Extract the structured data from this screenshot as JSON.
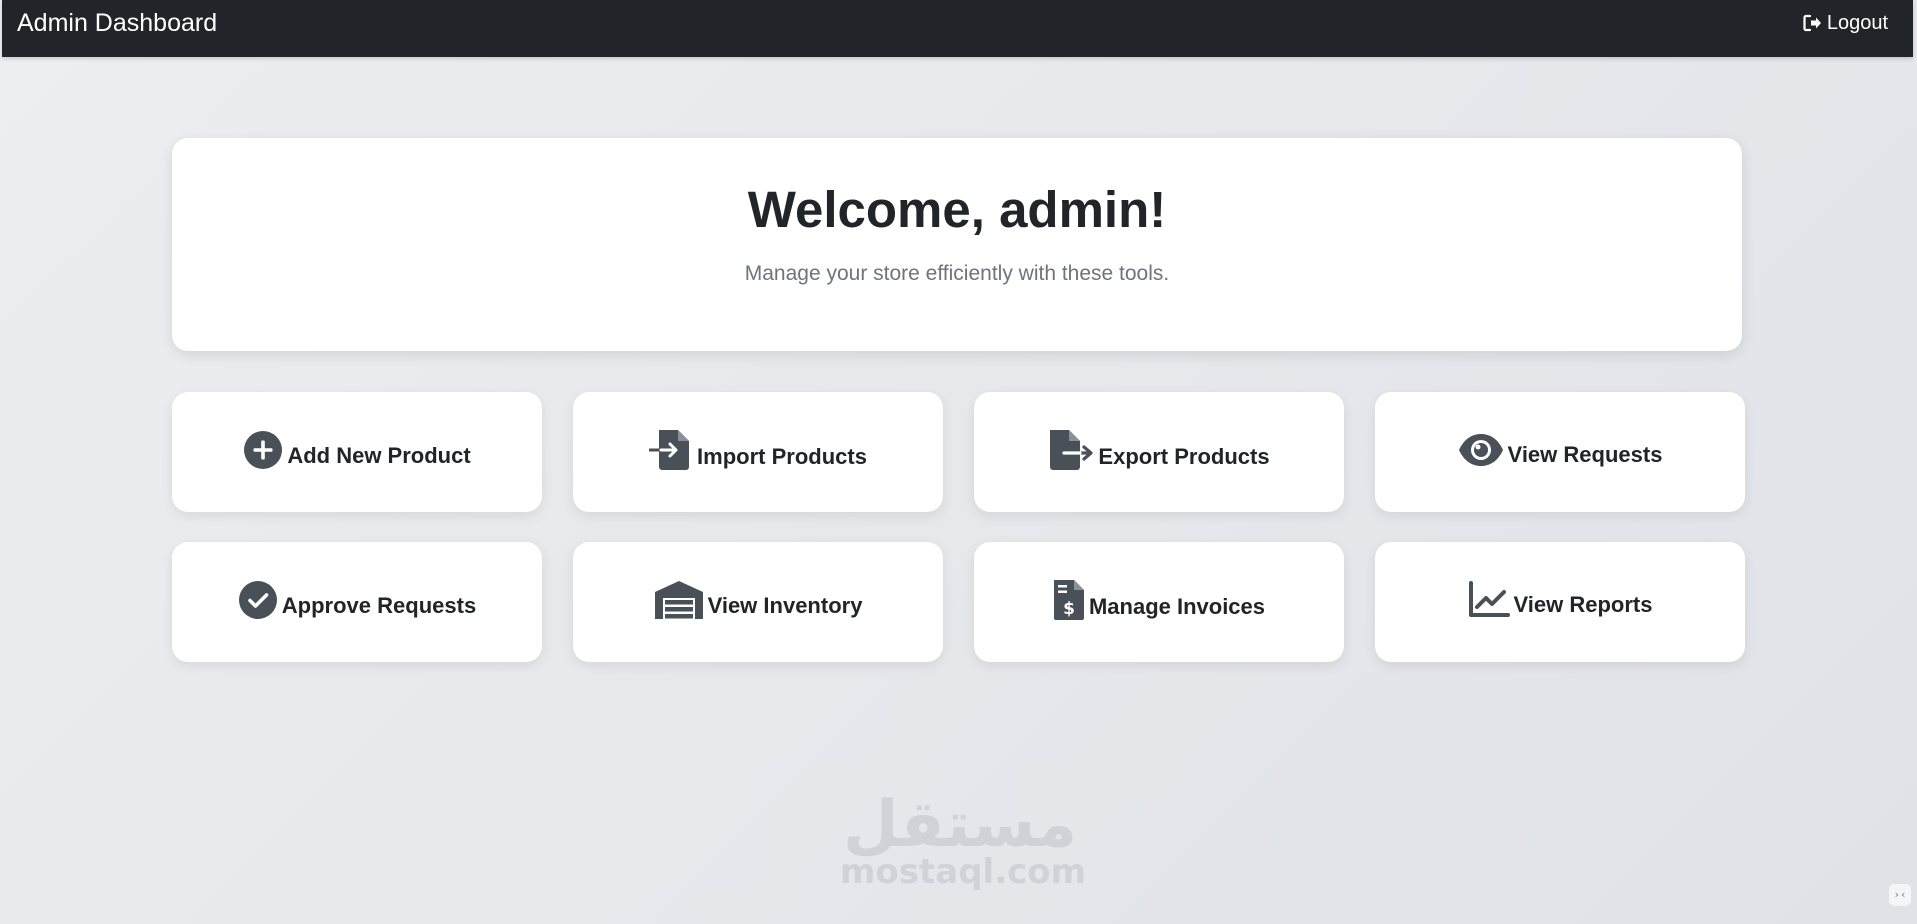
{
  "navbar": {
    "brand": "Admin Dashboard",
    "logout_label": "Logout",
    "logout_icon": "sign-out-icon"
  },
  "welcome": {
    "title": "Welcome, admin!",
    "subtitle": "Manage your store efficiently with these tools."
  },
  "tiles": [
    {
      "label": "Add New Product",
      "icon": "plus-circle-icon"
    },
    {
      "label": "Import Products",
      "icon": "file-import-icon"
    },
    {
      "label": "Export Products",
      "icon": "file-export-icon"
    },
    {
      "label": "View Requests",
      "icon": "eye-icon"
    },
    {
      "label": "Approve Requests",
      "icon": "check-circle-icon"
    },
    {
      "label": "View Inventory",
      "icon": "warehouse-icon"
    },
    {
      "label": "Manage Invoices",
      "icon": "invoice-dollar-icon"
    },
    {
      "label": "View Reports",
      "icon": "line-chart-icon"
    }
  ],
  "watermark": {
    "arabic": "مستقل",
    "latin": "mostaql.com"
  },
  "colors": {
    "navbar_bg": "#212529",
    "icon": "#495057",
    "text_dark": "#212529",
    "text_muted": "#6c757d"
  }
}
